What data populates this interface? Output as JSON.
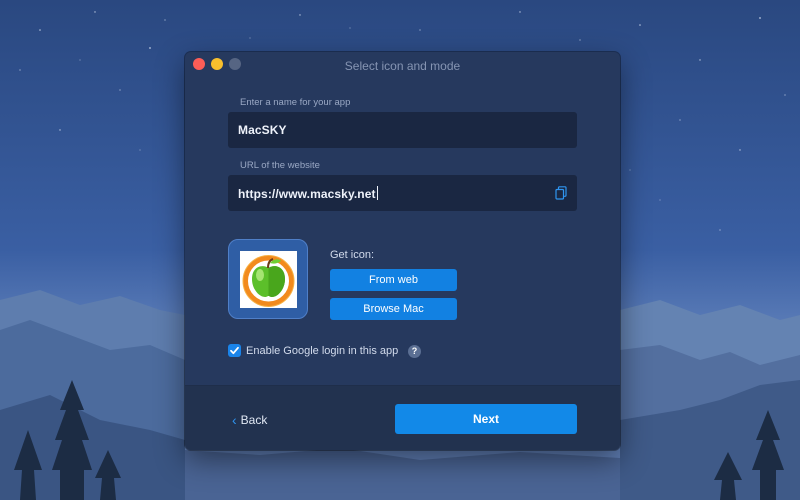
{
  "window": {
    "title": "Select icon and mode"
  },
  "form": {
    "name_label": "Enter a name for your app",
    "name_value": "MacSKY",
    "url_label": "URL of the website",
    "url_value": "https://www.macsky.net"
  },
  "icon_section": {
    "get_icon_label": "Get icon:",
    "from_web_label": "From web",
    "browse_mac_label": "Browse Mac",
    "icon_image": "green-apple-orange-ring-icon"
  },
  "options": {
    "google_login_label": "Enable Google login in this app",
    "google_login_checked": true,
    "help_glyph": "?"
  },
  "footer": {
    "back_label": "Back",
    "back_glyph": "‹",
    "next_label": "Next"
  },
  "colors": {
    "accent": "#1289e8",
    "window_bg": "#26395e",
    "field_bg": "#1a2742",
    "close": "#fc5d57",
    "minimize": "#f8bf2d"
  },
  "icons": [
    "copy-icon",
    "checkmark-icon",
    "help-icon",
    "chevron-left-icon",
    "app-icon"
  ]
}
